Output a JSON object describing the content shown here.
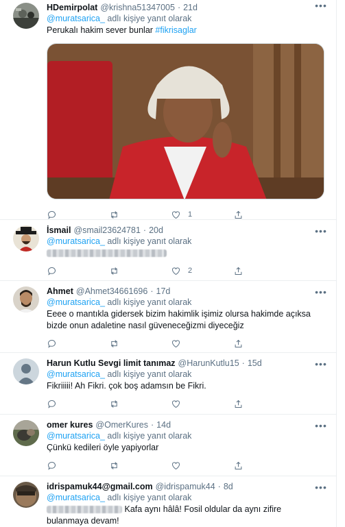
{
  "reply_prefix": "@muratsarica_",
  "reply_suffix": "adlı kişiye yanıt olarak",
  "more_glyph": "•••",
  "tweets": [
    {
      "name": "HDemirpolat",
      "handle": "@krishna51347005",
      "time": "21d",
      "text": "Perukalı hakim sever bunlar ",
      "hashtag": "#fikrisaglar",
      "has_media": true,
      "like_count": "1"
    },
    {
      "name": "İsmail",
      "handle": "@smail23624781",
      "time": "20d",
      "like_count": "2"
    },
    {
      "name": "Ahmet",
      "handle": "@Ahmet34661696",
      "time": "17d",
      "text": "Eeee o mantıkla gidersek bizim hakimlik işimiz olursa hakimde açıksa bizde onun adaletine nasıl güveneceğizmi diyeceğiz"
    },
    {
      "name": "Harun Kutlu Sevgi limit tanımaz",
      "handle": "@HarunKutlu15",
      "time": "15d",
      "text": "Fikriiiii! Ah Fikri. çok boş adamsın be Fikri."
    },
    {
      "name": "omer kures",
      "handle": "@OmerKures",
      "time": "14d",
      "text": "Çünkü kedileri öyle yapiyorlar"
    },
    {
      "name": "idrispamuk44@gmail.com",
      "handle": "@idrispamuk44",
      "time": "8d",
      "text": "Kafa aynı hâlâ! Fosil oldular da aynı zifire bulanmaya devam!"
    }
  ]
}
